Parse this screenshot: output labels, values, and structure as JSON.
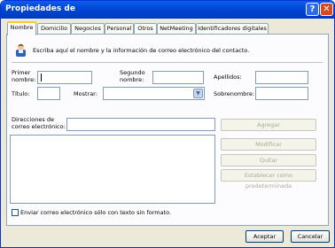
{
  "window": {
    "title": "Propiedades de",
    "help_glyph": "?",
    "close_glyph": "✕"
  },
  "tabs": [
    {
      "label": "Nombre",
      "active": true
    },
    {
      "label": "Domicilio"
    },
    {
      "label": "Negocios"
    },
    {
      "label": "Personal"
    },
    {
      "label": "Otros"
    },
    {
      "label": "NetMeeting"
    },
    {
      "label": "Identificadores digitales"
    }
  ],
  "intro": "Escriba aquí el nombre y la información de correo electrónico del contacto.",
  "fields": {
    "first_name_label": "Primer nombre:",
    "first_name_value": "",
    "middle_name_label": "Segundo nombre:",
    "middle_name_value": "",
    "last_name_label": "Apellidos:",
    "last_name_value": "",
    "title_label": "Título:",
    "title_value": "",
    "display_label": "Mostrar:",
    "display_value": "",
    "nickname_label": "Sobrenombre:",
    "nickname_value": "",
    "email_label": "Direcciones de correo electrónico:",
    "email_value": ""
  },
  "email_buttons": {
    "add": "Agregar",
    "edit": "Modificar",
    "remove": "Quitar",
    "set_default": "Establecer como predeterminada"
  },
  "plain_text_checkbox": {
    "label": "Enviar correo electrónico sólo con texto sin formato.",
    "checked": false
  },
  "footer": {
    "ok": "Aceptar",
    "cancel": "Cancelar"
  },
  "colors": {
    "titlebar": "#0046D5",
    "face": "#ECE9D8",
    "tab_highlight": "#FFC83C"
  }
}
